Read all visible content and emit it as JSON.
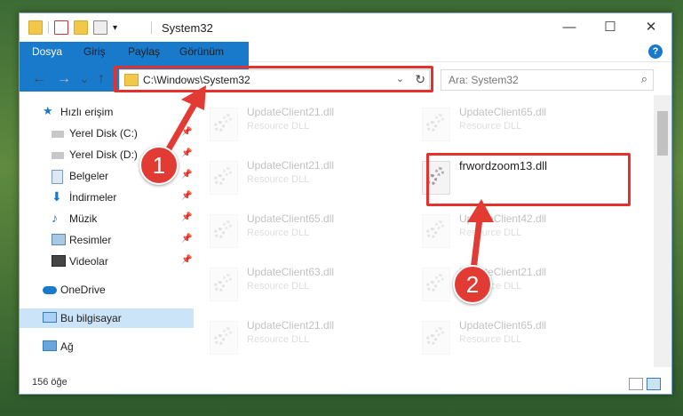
{
  "window": {
    "title": "System32",
    "minimize": "—",
    "maximize": "☐",
    "close": "✕"
  },
  "ribbon": {
    "tabs": [
      "Dosya",
      "Giriş",
      "Paylaş",
      "Görünüm"
    ],
    "help": "?"
  },
  "nav": {
    "back": "←",
    "forward": "→",
    "recent": "⌄",
    "up": "↑"
  },
  "address": {
    "path": "C:\\Windows\\System32",
    "dropdown": "⌄",
    "refresh": "↻"
  },
  "search": {
    "placeholder": "Ara: System32",
    "icon": "⌕"
  },
  "sidebar": {
    "items": [
      {
        "label": "Hızlı erişim",
        "icon": "star-icon"
      },
      {
        "label": "Yerel Disk (C:)",
        "icon": "drive-icon",
        "pinned": true
      },
      {
        "label": "Yerel Disk (D:)",
        "icon": "drive-icon",
        "pinned": true
      },
      {
        "label": "Belgeler",
        "icon": "documents-icon",
        "pinned": true
      },
      {
        "label": "İndirmeler",
        "icon": "download-icon",
        "pinned": true
      },
      {
        "label": "Müzik",
        "icon": "music-icon",
        "pinned": true
      },
      {
        "label": "Resimler",
        "icon": "pictures-icon",
        "pinned": true
      },
      {
        "label": "Videolar",
        "icon": "video-icon",
        "pinned": true
      },
      {
        "label": "OneDrive",
        "icon": "cloud-icon"
      },
      {
        "label": "Bu bilgisayar",
        "icon": "computer-icon",
        "selected": true
      },
      {
        "label": "Ağ",
        "icon": "network-icon"
      }
    ],
    "pin": "📌"
  },
  "files": [
    {
      "name": "UpdateClient21.dll",
      "type": "Resource DLL"
    },
    {
      "name": "UpdateClient65.dll",
      "type": "Resource DLL"
    },
    {
      "name": "UpdateClient21.dll",
      "type": "Resource DLL"
    },
    {
      "name": "frwordzoom13.dll",
      "type": ""
    },
    {
      "name": "UpdateClient65.dll",
      "type": "Resource DLL"
    },
    {
      "name": "UpdateClient42.dll",
      "type": "Resource DLL"
    },
    {
      "name": "UpdateClient63.dll",
      "type": "Resource DLL"
    },
    {
      "name": "UpdateClient21.dll",
      "type": "Resource DLL"
    },
    {
      "name": "UpdateClient21.dll",
      "type": "Resource DLL"
    },
    {
      "name": "UpdateClient65.dll",
      "type": "Resource DLL"
    }
  ],
  "status": {
    "count": "156 öğe"
  },
  "annotations": {
    "badge1": "1",
    "badge2": "2"
  },
  "colors": {
    "accent": "#1979ca",
    "highlight": "#e5312c",
    "selected": "#cce4f7"
  }
}
